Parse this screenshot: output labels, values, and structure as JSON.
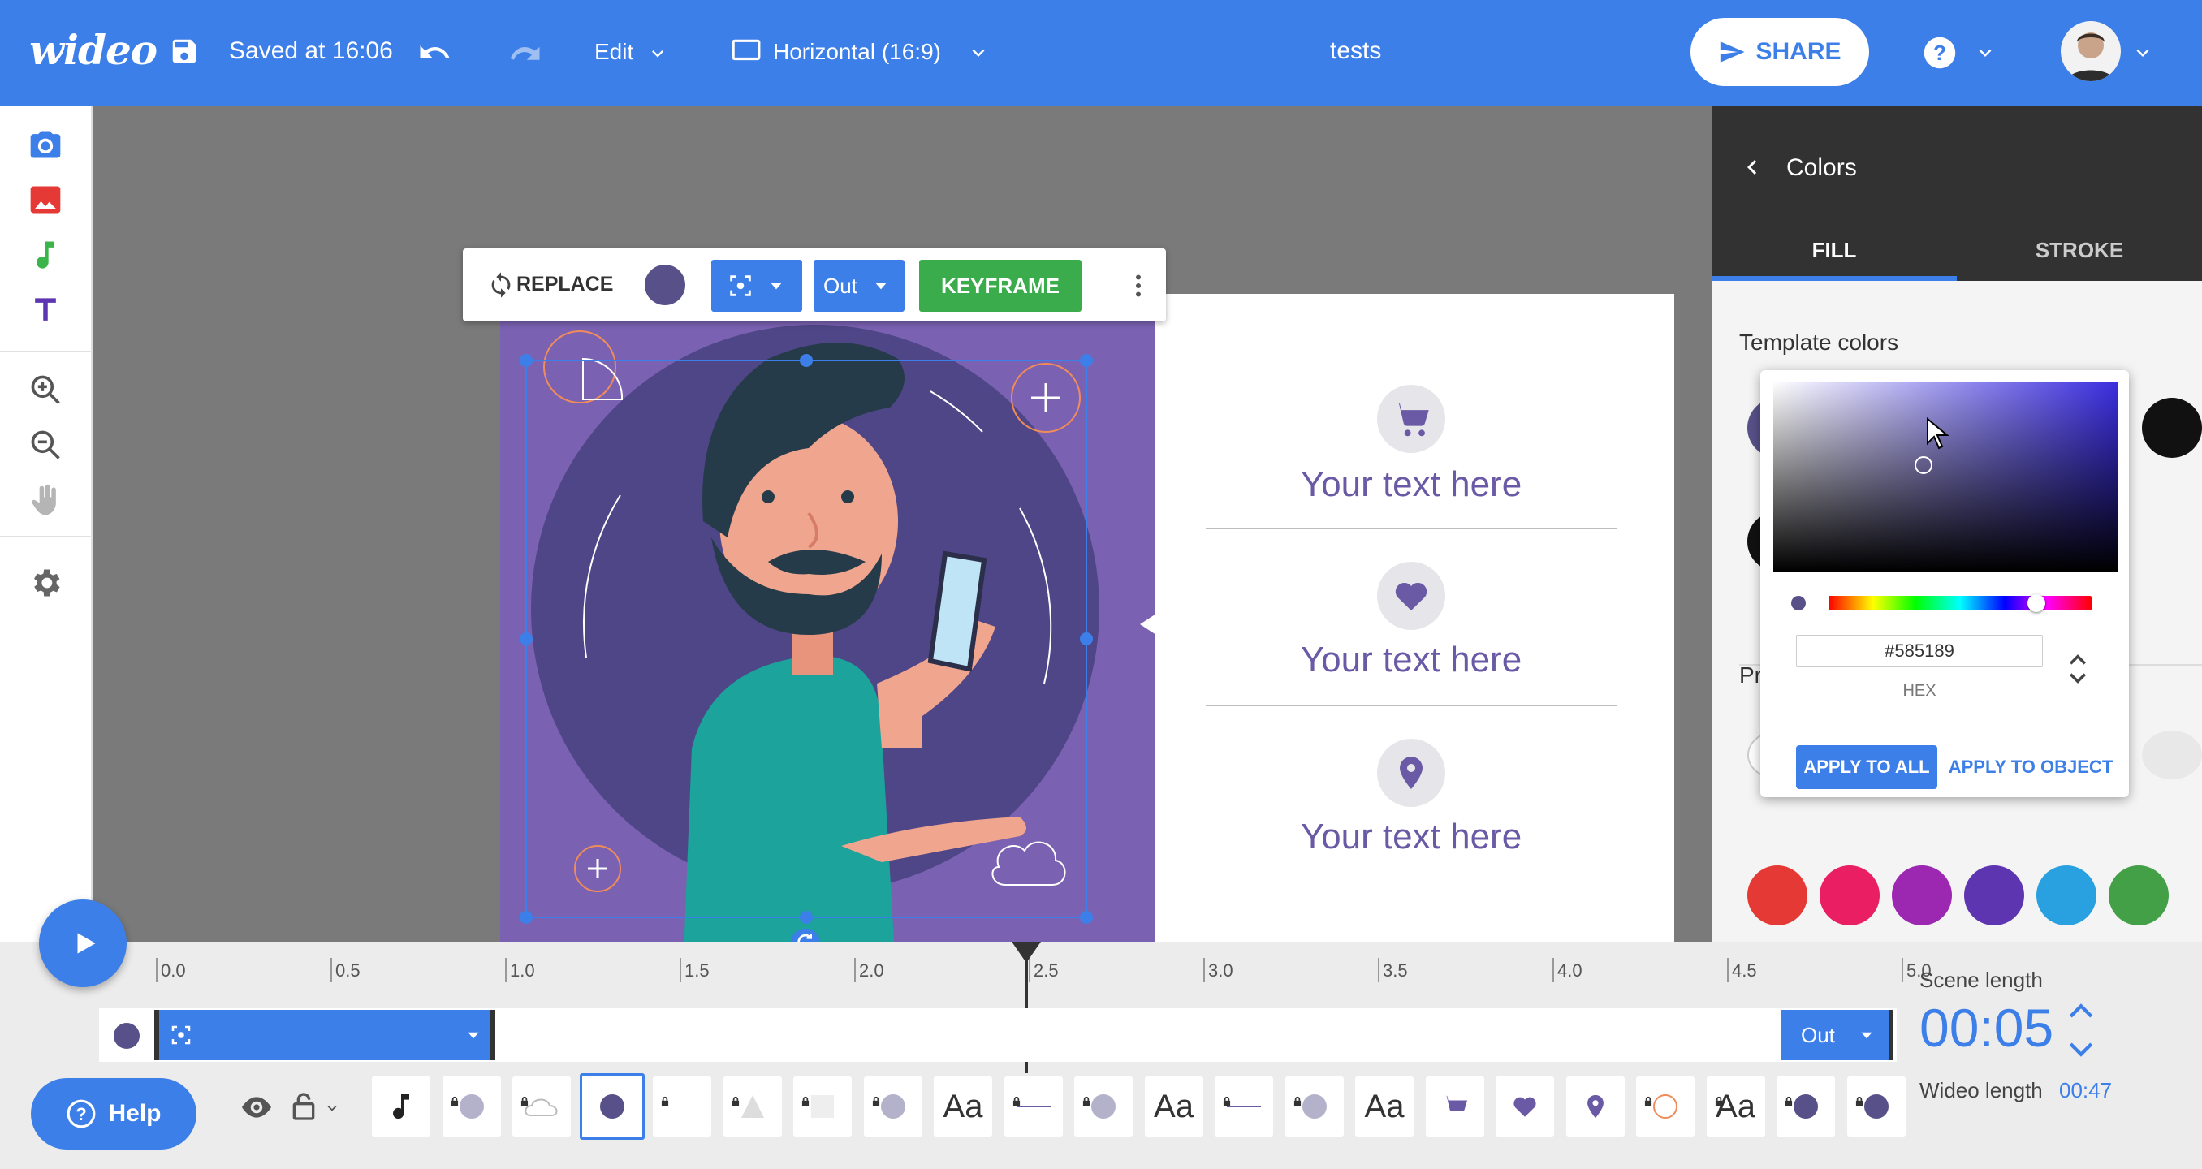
{
  "topbar": {
    "logo": "wideo",
    "saved": "Saved at 16:06",
    "edit_menu": "Edit",
    "aspect": "Horizontal (16:9)",
    "project_title": "tests",
    "share": "SHARE"
  },
  "toolbar": {
    "replace": "REPLACE",
    "fill_color": "#585189",
    "animation_out": "Out",
    "keyframe": "KEYFRAME"
  },
  "canvas": {
    "items": [
      {
        "icon": "cart-icon",
        "text": "Your text here"
      },
      {
        "icon": "heart-icon",
        "text": "Your text here"
      },
      {
        "icon": "location-pin-icon",
        "text": "Your text here"
      }
    ],
    "panel_color": "#7b61b2"
  },
  "right_panel": {
    "title": "Colors",
    "tabs": [
      "FILL",
      "STROKE"
    ],
    "template_colors_label": "Template colors",
    "partial_label": "Pr",
    "palette": [
      "#e53935",
      "#e91e63",
      "#9c27b0",
      "#5e35b1",
      "#29a0e0",
      "#43a047"
    ]
  },
  "picker": {
    "hex_value": "#585189",
    "hex_label": "HEX",
    "apply_all": "APPLY TO ALL",
    "apply_object": "APPLY TO OBJECT",
    "hue_position": 0.79
  },
  "timeline": {
    "ticks": [
      "0.0",
      "0.5",
      "1.0",
      "1.5",
      "2.0",
      "2.5",
      "3.0",
      "3.5",
      "4.0",
      "4.5",
      "5.0"
    ],
    "playhead": "2.5",
    "track_out": "Out",
    "scene_length_label": "Scene length",
    "scene_length": "00:05",
    "wideo_length_label": "Wideo length",
    "wideo_length": "00:47",
    "help": "Help",
    "elements_text": "Aa"
  }
}
